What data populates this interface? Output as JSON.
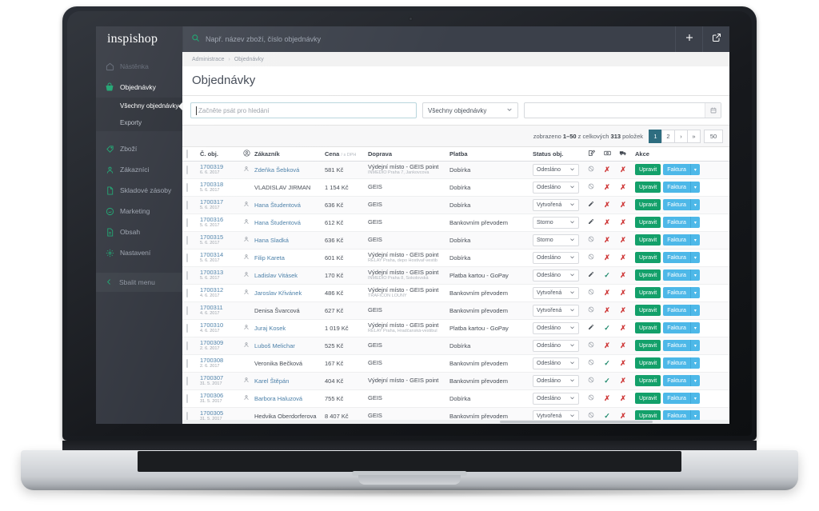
{
  "brand": {
    "name": "inspishop"
  },
  "topbar": {
    "search_placeholder": "Např. název zboží, číslo objednávky",
    "search_icon": "search-icon",
    "add_icon": "plus-icon",
    "open_icon": "external-link-icon"
  },
  "sidebar": {
    "items": [
      {
        "label": "Nástěnka",
        "icon": "home-icon",
        "state": "dim"
      },
      {
        "label": "Objednávky",
        "icon": "basket-icon",
        "state": "parent-active"
      },
      {
        "label": "Zboží",
        "icon": "tag-icon",
        "state": "normal"
      },
      {
        "label": "Zákazníci",
        "icon": "users-icon",
        "state": "normal"
      },
      {
        "label": "Skladové zásoby",
        "icon": "file-icon",
        "state": "normal"
      },
      {
        "label": "Marketing",
        "icon": "megaphone-icon",
        "state": "normal"
      },
      {
        "label": "Obsah",
        "icon": "document-icon",
        "state": "normal"
      },
      {
        "label": "Nastavení",
        "icon": "gear-icon",
        "state": "normal"
      }
    ],
    "subitems": [
      {
        "label": "Všechny objednávky",
        "active": true
      },
      {
        "label": "Exporty",
        "active": false
      }
    ],
    "collapse_label": "Sbalit menu",
    "collapse_icon": "chevron-left-icon"
  },
  "breadcrumb": {
    "root": "Administrace",
    "separator": "›",
    "current": "Objednávky"
  },
  "page": {
    "title": "Objednávky"
  },
  "filters": {
    "search_placeholder": "Začněte psát pro hledání",
    "search_value": "",
    "select_value": "Všechny objednávky",
    "select_caret": "chevron-down-icon",
    "date_value": "",
    "date_icon": "calendar-icon"
  },
  "pagination": {
    "info_prefix": "zobrazeno",
    "info_range": "1–50",
    "info_mid": "z celkových",
    "info_total": "313",
    "info_suffix": "položek",
    "pages": [
      "1",
      "2",
      "›",
      "»"
    ],
    "active_page": "1",
    "page_size": "50"
  },
  "table": {
    "columns": {
      "checkbox": "",
      "order": "Č. obj.",
      "customer_icon": "user-circle-icon",
      "customer": "Zákazník",
      "price": "Cena",
      "price_note": "/ s DPH",
      "shipping": "Doprava",
      "payment": "Platba",
      "status": "Status obj.",
      "icon_edit": "note-edit-icon",
      "icon_money": "money-icon",
      "icon_truck": "truck-icon",
      "actions": "Akce"
    },
    "buttons": {
      "edit": "Upravit",
      "invoice": "Faktura",
      "caret": "caret-down-icon"
    },
    "rows": [
      {
        "num": "1700319",
        "date": "6. 6. 2017",
        "has_user": true,
        "customer": "Zdeňka Šebková",
        "customer_link": true,
        "price": "581 Kč",
        "ship": "Výdejní místo - GEIS point",
        "ship_sub": "INMEDIO Praha 7, Jankovcova",
        "payment": "Dobírka",
        "status": "Odesláno",
        "i1": "ban",
        "i2": "x",
        "i3": "x"
      },
      {
        "num": "1700318",
        "date": "5. 6. 2017",
        "has_user": false,
        "customer": "VLADISLAV JIRMAN",
        "customer_link": false,
        "price": "1 154 Kč",
        "ship": "GEIS",
        "ship_sub": "",
        "payment": "Dobírka",
        "status": "Odesláno",
        "i1": "ban",
        "i2": "x",
        "i3": "x"
      },
      {
        "num": "1700317",
        "date": "5. 6. 2017",
        "has_user": true,
        "customer": "Hana Študentová",
        "customer_link": true,
        "price": "636 Kč",
        "ship": "GEIS",
        "ship_sub": "",
        "payment": "Dobírka",
        "status": "Vytvořená",
        "i1": "pencil",
        "i2": "x",
        "i3": "x"
      },
      {
        "num": "1700316",
        "date": "5. 6. 2017",
        "has_user": true,
        "customer": "Hana Študentová",
        "customer_link": true,
        "price": "612 Kč",
        "ship": "GEIS",
        "ship_sub": "",
        "payment": "Bankovním převodem",
        "status": "Storno",
        "i1": "pencil",
        "i2": "x",
        "i3": "x"
      },
      {
        "num": "1700315",
        "date": "5. 6. 2017",
        "has_user": true,
        "customer": "Hana Sladká",
        "customer_link": true,
        "price": "636 Kč",
        "ship": "GEIS",
        "ship_sub": "",
        "payment": "Dobírka",
        "status": "Storno",
        "i1": "ban",
        "i2": "x",
        "i3": "x"
      },
      {
        "num": "1700314",
        "date": "5. 6. 2017",
        "has_user": true,
        "customer": "Filip Kareta",
        "customer_link": true,
        "price": "601 Kč",
        "ship": "Výdejní místo - GEIS point",
        "ship_sub": "RELAY Praha, depo Hostivař-vestib",
        "payment": "Dobírka",
        "status": "Odesláno",
        "i1": "ban",
        "i2": "x",
        "i3": "x"
      },
      {
        "num": "1700313",
        "date": "5. 6. 2017",
        "has_user": true,
        "customer": "Ladislav Vitásek",
        "customer_link": true,
        "price": "170 Kč",
        "ship": "Výdejní místo - GEIS point",
        "ship_sub": "INMEDIO Praha 8, Sokolovská",
        "payment": "Platba kartou - GoPay",
        "status": "Odesláno",
        "i1": "pencil",
        "i2": "v",
        "i3": "x"
      },
      {
        "num": "1700312",
        "date": "4. 6. 2017",
        "has_user": true,
        "customer": "Jaroslav Křivánek",
        "customer_link": true,
        "price": "486 Kč",
        "ship": "Výdejní místo - GEIS point",
        "ship_sub": "TRAFICON LOUNY",
        "payment": "Bankovním převodem",
        "status": "Vytvořená",
        "i1": "ban",
        "i2": "x",
        "i3": "x"
      },
      {
        "num": "1700311",
        "date": "4. 6. 2017",
        "has_user": false,
        "customer": "Denisa Švarcová",
        "customer_link": false,
        "price": "627 Kč",
        "ship": "GEIS",
        "ship_sub": "",
        "payment": "Bankovním převodem",
        "status": "Vytvořená",
        "i1": "ban",
        "i2": "x",
        "i3": "x"
      },
      {
        "num": "1700310",
        "date": "4. 6. 2017",
        "has_user": true,
        "customer": "Juraj Kosek",
        "customer_link": true,
        "price": "1 019 Kč",
        "ship": "Výdejní místo - GEIS point",
        "ship_sub": "RELAY Praha, Hradčanská-vestibul",
        "payment": "Platba kartou - GoPay",
        "status": "Odesláno",
        "i1": "pencil",
        "i2": "v",
        "i3": "x"
      },
      {
        "num": "1700309",
        "date": "2. 6. 2017",
        "has_user": true,
        "customer": "Luboš Melichar",
        "customer_link": true,
        "price": "525 Kč",
        "ship": "GEIS",
        "ship_sub": "",
        "payment": "Dobírka",
        "status": "Odesláno",
        "i1": "ban",
        "i2": "x",
        "i3": "x"
      },
      {
        "num": "1700308",
        "date": "2. 6. 2017",
        "has_user": false,
        "customer": "Veronika Bečková",
        "customer_link": false,
        "price": "167 Kč",
        "ship": "GEIS",
        "ship_sub": "",
        "payment": "Bankovním převodem",
        "status": "Odesláno",
        "i1": "ban",
        "i2": "v",
        "i3": "x"
      },
      {
        "num": "1700307",
        "date": "31. 5. 2017",
        "has_user": true,
        "customer": "Karel Štěpán",
        "customer_link": true,
        "price": "404 Kč",
        "ship": "Výdejní místo - GEIS point",
        "ship_sub": "",
        "payment": "Bankovním převodem",
        "status": "Odesláno",
        "i1": "ban",
        "i2": "v",
        "i3": "x"
      },
      {
        "num": "1700306",
        "date": "31. 5. 2017",
        "has_user": true,
        "customer": "Barbora Haluzová",
        "customer_link": true,
        "price": "755 Kč",
        "ship": "GEIS",
        "ship_sub": "",
        "payment": "Dobírka",
        "status": "Odesláno",
        "i1": "ban",
        "i2": "x",
        "i3": "x"
      },
      {
        "num": "1700305",
        "date": "31. 5. 2017",
        "has_user": false,
        "customer": "Hedvika Oberdorferova",
        "customer_link": false,
        "price": "8 407 Kč",
        "ship": "GEIS",
        "ship_sub": "",
        "payment": "Bankovním převodem",
        "status": "Vytvořená",
        "i1": "ban",
        "i2": "v",
        "i3": "x"
      }
    ]
  },
  "colors": {
    "sidebar_bg": "#2c3039",
    "accent_green": "#13a06a",
    "accent_blue": "#4db8e8",
    "page_active": "#2e6d80",
    "danger": "#cf3a3a",
    "link": "#4a7fa8"
  }
}
